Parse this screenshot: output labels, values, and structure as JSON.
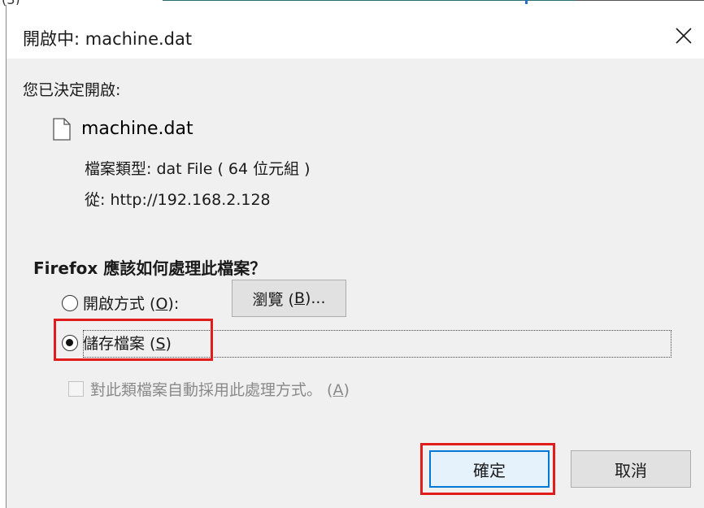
{
  "window": {
    "title": "開啟中: machine.dat"
  },
  "intro": {
    "text": "您已決定開啟:"
  },
  "file": {
    "name": "machine.dat",
    "type_line": "檔案類型: dat File ( 64 位元組 )",
    "from_line": "從: http://192.168.2.128"
  },
  "question": {
    "text": "Firefox 應該如何處理此檔案？"
  },
  "options": {
    "open_with": {
      "label_prefix": "開啟方式 (",
      "label_key": "O",
      "label_suffix": "):",
      "checked": false
    },
    "browse": {
      "label_prefix": "瀏覽 (",
      "label_key": "B",
      "label_suffix": ")..."
    },
    "save_file": {
      "label_prefix": "儲存檔案 (",
      "label_key": "S",
      "label_suffix": ")",
      "checked": true
    },
    "auto": {
      "label_prefix": "對此類檔案自動採用此處理方式。 (",
      "label_key": "A",
      "label_suffix": ")",
      "checked": false,
      "enabled": false
    }
  },
  "buttons": {
    "ok": "確定",
    "cancel": "取消"
  },
  "top_strip": {
    "cut_text": "(3)"
  },
  "colors": {
    "highlight": "#e21b1b",
    "focus_border": "#0078d7",
    "dialog_bg": "#f0f0f0"
  },
  "icons": {
    "close": "close-icon",
    "file": "document-icon"
  }
}
